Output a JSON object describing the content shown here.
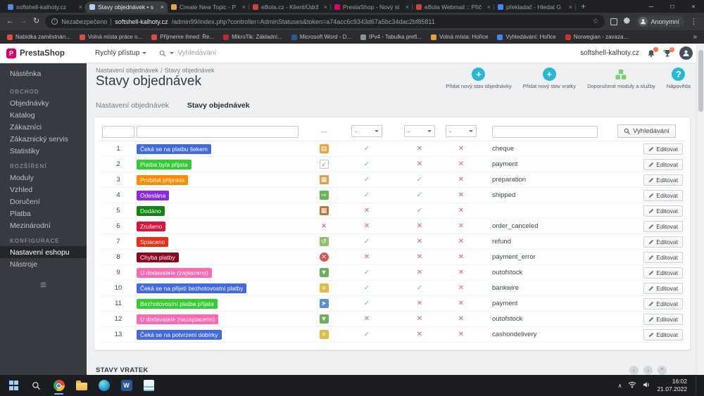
{
  "browser": {
    "tabs": [
      {
        "title": "softshell-kalhoty.cz",
        "favicon": "#4a90d9",
        "active": false
      },
      {
        "title": "Stavy objednávek • s",
        "favicon": "#b9cfe8",
        "active": true
      },
      {
        "title": "Create New Topic - P",
        "favicon": "#e8a33d",
        "active": false
      },
      {
        "title": "eBola.cz - Klient/Údrž",
        "favicon": "#d04437",
        "active": false
      },
      {
        "title": "PrestaShop - Nový st",
        "favicon": "#df0067",
        "active": false
      },
      {
        "title": "eBola Webmail :: Přič",
        "favicon": "#d04437",
        "active": false
      },
      {
        "title": "překladač - Hledat G",
        "favicon": "#4285f4",
        "active": false
      }
    ],
    "new_tab_button": "+",
    "window_controls": [
      "─",
      "□",
      "×"
    ],
    "nav": {
      "back": "←",
      "forward": "→",
      "reload": "↻"
    },
    "security_label": "Nezabezpečeno",
    "url_host": "softshell-kalhoty.cz",
    "url_path": "/admin99/index.php?controller=AdminStatuses&token=a74acc6c9343d67a5bc34dac2bf85811",
    "profile_name": "Anonymní",
    "menu_icon": "⋮",
    "bookmarks": [
      {
        "label": "Nabídka zaměstnán...",
        "color": "#e04a3f"
      },
      {
        "label": "Volná místa práce n...",
        "color": "#e04a3f"
      },
      {
        "label": "Přijmeme ihned: Ře...",
        "color": "#e04a3f"
      },
      {
        "label": "MikroTik: Základní...",
        "color": "#c2262e"
      },
      {
        "label": "Microsoft Word - D...",
        "color": "#2b579a"
      },
      {
        "label": "IPv4 - Tabulka prefi...",
        "color": "#8a9096"
      },
      {
        "label": "Volná místa: Hořice",
        "color": "#e8a33d"
      },
      {
        "label": "Vyhledávání: Hořice",
        "color": "#4285f4"
      },
      {
        "label": "Norwegian - zavaza...",
        "color": "#d32f2f"
      }
    ],
    "bookmarks_overflow": "»"
  },
  "admin_header": {
    "logo_text": "PrestaShop",
    "logo_initial": "P",
    "quick_access_label": "Rychlý přístup",
    "search_placeholder": "Vyhledávání",
    "shop_link": "softshell-kalhoty.cz",
    "notification_count": "1"
  },
  "sidebar": {
    "top_item": "Nástěnka",
    "sections": [
      {
        "title": "OBCHOD",
        "items": [
          "Objednávky",
          "Katalog",
          "Zákazníci",
          "Zákaznický servis",
          "Statistiky"
        ]
      },
      {
        "title": "ROZŠÍŘENÍ",
        "items": [
          "Moduly",
          "Vzhled",
          "Doručení",
          "Platba",
          "Mezinárodní"
        ]
      },
      {
        "title": "KONFIGURACE",
        "items": [
          "Nastavení eshopu",
          "Nástroje"
        ],
        "active_item": "Nastavení eshopu"
      }
    ]
  },
  "page": {
    "breadcrumb": [
      "Nastavení objednávek",
      "Stavy objednávek"
    ],
    "breadcrumb_separator": "/",
    "title": "Stavy objednávek",
    "header_actions": [
      {
        "label": "Přidat nový stav objednávky",
        "icon": "plus",
        "color": "#25b9d7"
      },
      {
        "label": "Přidat nový stav vratky",
        "icon": "plus",
        "color": "#25b9d7"
      },
      {
        "label": "Doporučené moduly a služby",
        "icon": "modules",
        "color": "#78cf75"
      },
      {
        "label": "Nápověda",
        "icon": "help",
        "color": "#25b9d7"
      }
    ],
    "tabs": [
      {
        "label": "Nastavení objednávek",
        "active": false
      },
      {
        "label": "Stavy objednávek",
        "active": true
      }
    ],
    "next_section_title": "STAVY VRATEK"
  },
  "table": {
    "filter_icon_placeholder": "—",
    "select_placeholder": "-",
    "search_button_label": "Vyhledávání",
    "edit_button_label": "Editovat",
    "rows": [
      {
        "id": 1,
        "name": "Čeká se na platbu šekem",
        "badge": "#4169E1",
        "icon": {
          "glyph": "▤",
          "bg": "#e8a33d",
          "fg": "#ffffff"
        },
        "flags": [
          true,
          false,
          false
        ],
        "template": "cheque"
      },
      {
        "id": 2,
        "name": "Platba byla přijata",
        "badge": "#32CD32",
        "icon": {
          "glyph": "✓",
          "bg": "#ffffff",
          "fg": "#4faf46",
          "border": "#b8cdb6"
        },
        "flags": [
          true,
          false,
          false
        ],
        "template": "payment"
      },
      {
        "id": 3,
        "name": "Probíhá příprava",
        "badge": "#FF8C00",
        "icon": {
          "glyph": "▦",
          "bg": "#d8a24a",
          "fg": "#ffffff"
        },
        "flags": [
          true,
          true,
          false
        ],
        "template": "preparation"
      },
      {
        "id": 4,
        "name": "Odeslána",
        "badge": "#8A2BE2",
        "icon": {
          "glyph": "⇨",
          "bg": "#67b457",
          "fg": "#ffffff"
        },
        "flags": [
          true,
          true,
          false
        ],
        "template": "shipped"
      },
      {
        "id": 5,
        "name": "Dodáno",
        "badge": "#108510",
        "icon": {
          "glyph": "▦",
          "bg": "#b5793a",
          "fg": "#ffffff"
        },
        "flags": [
          false,
          true,
          false
        ],
        "template": ""
      },
      {
        "id": 6,
        "name": "Zrušeno",
        "badge": "#DC143C",
        "icon": {
          "glyph": "✕",
          "bg": "transparent",
          "fg": "#e23b3b"
        },
        "flags": [
          false,
          false,
          false
        ],
        "template": "order_canceled"
      },
      {
        "id": 7,
        "name": "Splaceno",
        "badge": "#EC2E15",
        "icon": {
          "glyph": "↺",
          "bg": "#8ec06c",
          "fg": "#ffffff"
        },
        "flags": [
          true,
          false,
          false
        ],
        "template": "refund"
      },
      {
        "id": 8,
        "name": "Chyba platby",
        "badge": "#8F0621",
        "icon": {
          "glyph": "✕",
          "bg": "#d9534f",
          "fg": "#ffffff",
          "round": true
        },
        "flags": [
          false,
          false,
          false
        ],
        "template": "payment_error"
      },
      {
        "id": 9,
        "name": "U dodavatele (zaplaceno)",
        "badge": "#FF69B4",
        "icon": {
          "glyph": "▼",
          "bg": "#6fae5c",
          "fg": "#ffffff"
        },
        "flags": [
          true,
          false,
          false
        ],
        "template": "outofstock"
      },
      {
        "id": 10,
        "name": "Čeká se na přijetí bezhotovostní platby",
        "badge": "#4169E1",
        "icon": {
          "glyph": "¤",
          "bg": "#e3bb45",
          "fg": "#ffffff"
        },
        "flags": [
          true,
          true,
          false
        ],
        "template": "bankwire"
      },
      {
        "id": 11,
        "name": "Bezhotovostní platba přijata",
        "badge": "#32CD32",
        "icon": {
          "glyph": "➤",
          "bg": "#5b8fd4",
          "fg": "#ffffff"
        },
        "flags": [
          true,
          false,
          false
        ],
        "template": "payment"
      },
      {
        "id": 12,
        "name": "U dodavatele (nezaplaceno)",
        "badge": "#FF69B4",
        "icon": {
          "glyph": "▼",
          "bg": "#6fae5c",
          "fg": "#ffffff"
        },
        "flags": [
          false,
          false,
          false
        ],
        "template": "outofstock"
      },
      {
        "id": 13,
        "name": "Čeká se na potvrzení dobírky",
        "badge": "#4169E1",
        "icon": {
          "glyph": "¤",
          "bg": "#e3bb45",
          "fg": "#ffffff"
        },
        "flags": [
          true,
          false,
          false
        ],
        "template": "cashondelivery"
      }
    ]
  },
  "taskbar": {
    "time": "16:02",
    "date": "21.07.2022",
    "apps": [
      "start",
      "search",
      "chrome",
      "explorer",
      "edge",
      "word",
      "notes"
    ]
  }
}
